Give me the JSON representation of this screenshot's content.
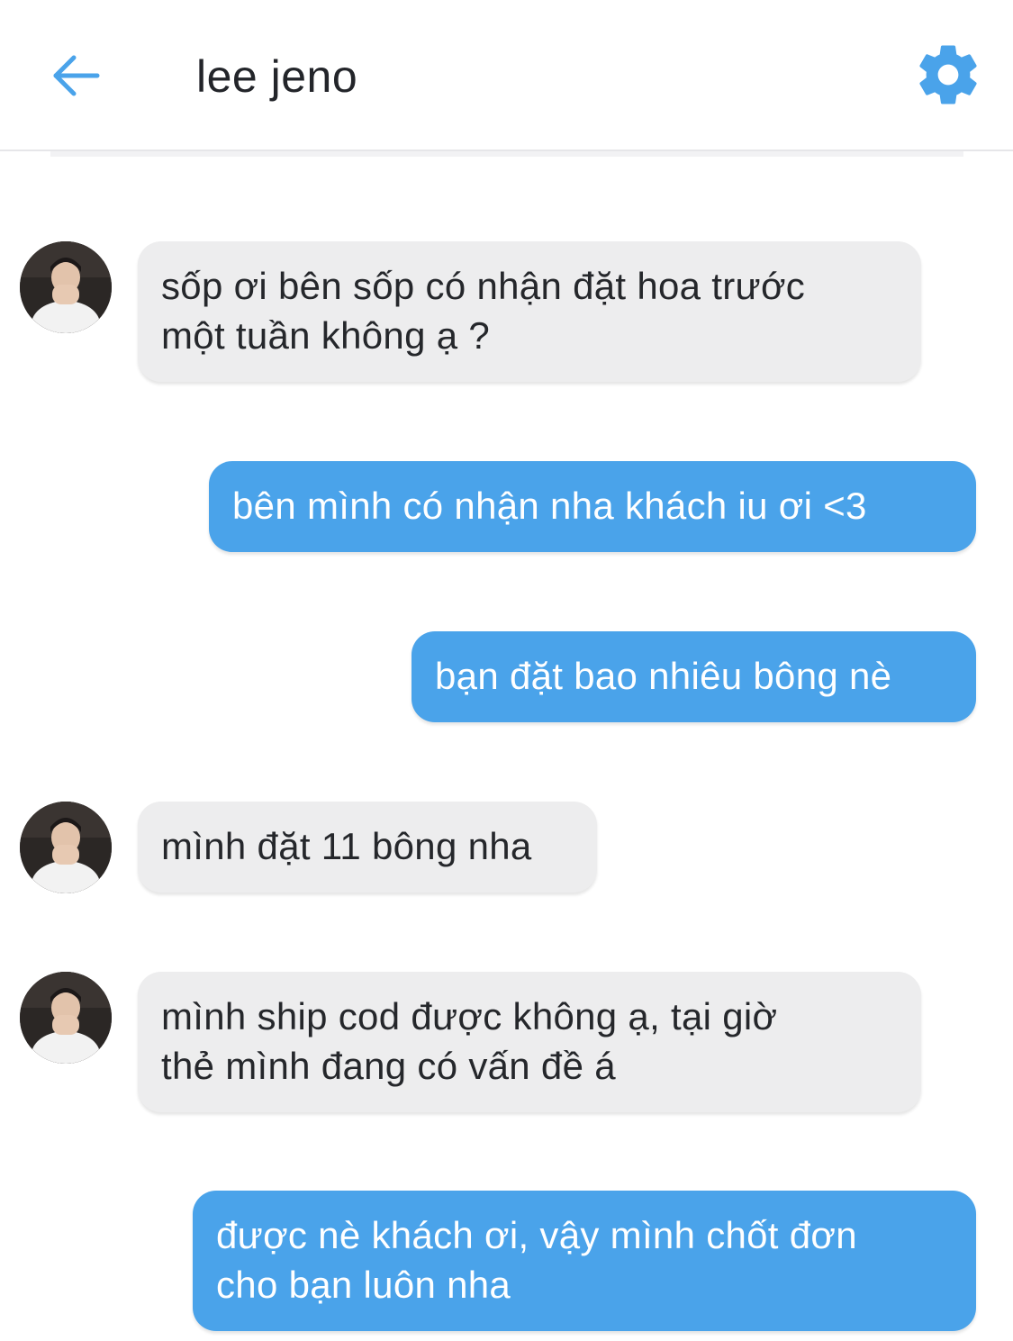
{
  "header": {
    "title": "lee jeno",
    "back_icon": "arrow-left-icon",
    "settings_icon": "gear-icon",
    "accent_color": "#4aa3ea"
  },
  "conversation": {
    "messages": [
      {
        "direction": "incoming",
        "text": "sốp ơi bên sốp có nhận đặt hoa trước\nmột tuần không ạ ?"
      },
      {
        "direction": "outgoing",
        "text": "bên mình có nhận nha khách iu ơi <3"
      },
      {
        "direction": "outgoing",
        "text": "bạn đặt bao nhiêu bông nè"
      },
      {
        "direction": "incoming",
        "text": "mình đặt 11 bông nha"
      },
      {
        "direction": "incoming",
        "text": "mình ship cod được không ạ, tại giờ\nthẻ mình đang có vấn đề á"
      },
      {
        "direction": "outgoing",
        "text": "được nè khách ơi, vậy mình chốt đơn\ncho bạn luôn nha"
      }
    ]
  }
}
